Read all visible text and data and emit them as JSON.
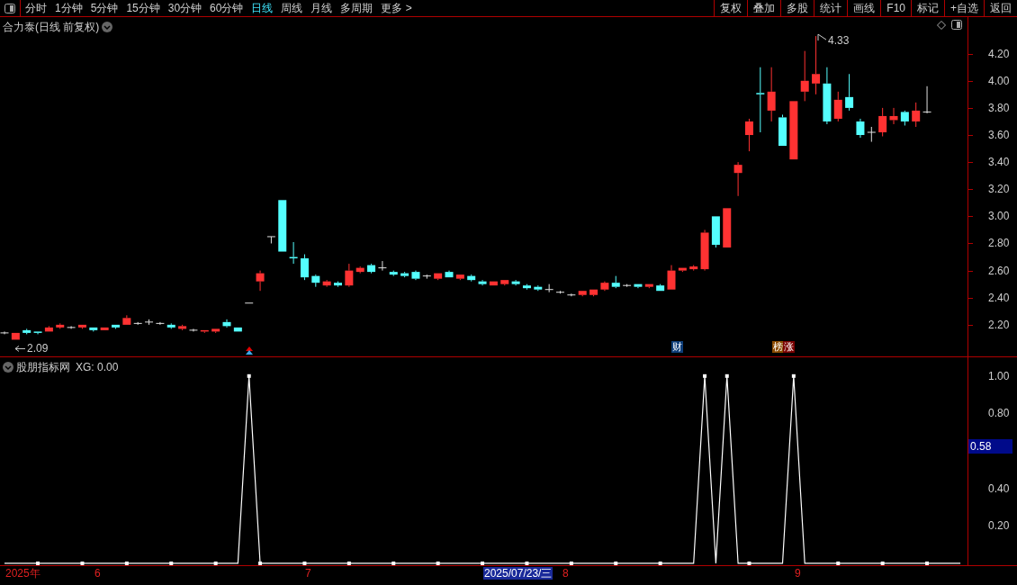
{
  "toolbar": {
    "periods": [
      {
        "label": "分时",
        "selected": false
      },
      {
        "label": "1分钟",
        "selected": false
      },
      {
        "label": "5分钟",
        "selected": false
      },
      {
        "label": "15分钟",
        "selected": false
      },
      {
        "label": "30分钟",
        "selected": false
      },
      {
        "label": "60分钟",
        "selected": false
      },
      {
        "label": "日线",
        "selected": true
      },
      {
        "label": "周线",
        "selected": false
      },
      {
        "label": "月线",
        "selected": false
      },
      {
        "label": "多周期",
        "selected": false
      },
      {
        "label": "更多 >",
        "selected": false
      }
    ],
    "actions": [
      "复权",
      "叠加",
      "多股",
      "统计",
      "画线",
      "F10",
      "标记",
      "+自选",
      "返回"
    ]
  },
  "main_chart": {
    "title": "合力泰(日线 前复权)",
    "low_label": "2.09",
    "high_label": "4.33",
    "markers": [
      {
        "label": "财",
        "color": "#0d3d78"
      },
      {
        "label": "榜",
        "color": "#8a4a00"
      },
      {
        "label": "涨",
        "color": "#7a0000"
      }
    ],
    "chart_data": {
      "type": "candlestick",
      "ylim": [
        1.96,
        4.47
      ],
      "yticks": [
        {
          "value": 4.2,
          "label": "4.20"
        },
        {
          "value": 4.0,
          "label": "4.00"
        },
        {
          "value": 3.8,
          "label": "3.80"
        },
        {
          "value": 3.6,
          "label": "3.60"
        },
        {
          "value": 3.4,
          "label": "3.40"
        },
        {
          "value": 3.2,
          "label": "3.20"
        },
        {
          "value": 3.0,
          "label": "3.00"
        },
        {
          "value": 2.8,
          "label": "2.80"
        },
        {
          "value": 2.6,
          "label": "2.60"
        },
        {
          "value": 2.4,
          "label": "2.40"
        },
        {
          "value": 2.2,
          "label": "2.20"
        }
      ],
      "categories": [
        null,
        null,
        null,
        null,
        null,
        null,
        null,
        null,
        null,
        null,
        null,
        null,
        null,
        null,
        null,
        null,
        null,
        null,
        null,
        null,
        null,
        null,
        null,
        null,
        null,
        null,
        null,
        null,
        null,
        null,
        null,
        null,
        null,
        null,
        null,
        null,
        null,
        null,
        null,
        null,
        null,
        null,
        null,
        null,
        null,
        null,
        null,
        null,
        null,
        null,
        null,
        null,
        null,
        null,
        null,
        null,
        null,
        null,
        null,
        null,
        null,
        null,
        null,
        null,
        null,
        null,
        null,
        null,
        null,
        null,
        null,
        null,
        null,
        null,
        null,
        null,
        null,
        null,
        null,
        null,
        null,
        null,
        null,
        null
      ],
      "ohlc": [
        [
          2.14,
          2.15,
          2.13,
          2.14
        ],
        [
          2.09,
          2.14,
          2.09,
          2.14
        ],
        [
          2.16,
          2.17,
          2.13,
          2.14
        ],
        [
          2.15,
          2.15,
          2.13,
          2.14
        ],
        [
          2.15,
          2.19,
          2.15,
          2.18
        ],
        [
          2.18,
          2.21,
          2.17,
          2.2
        ],
        [
          2.18,
          2.19,
          2.17,
          2.18
        ],
        [
          2.18,
          2.2,
          2.17,
          2.2
        ],
        [
          2.18,
          2.18,
          2.15,
          2.16
        ],
        [
          2.16,
          2.18,
          2.16,
          2.18
        ],
        [
          2.2,
          2.2,
          2.17,
          2.18
        ],
        [
          2.2,
          2.27,
          2.2,
          2.25
        ],
        [
          2.21,
          2.22,
          2.2,
          2.21
        ],
        [
          2.22,
          2.24,
          2.2,
          2.22
        ],
        [
          2.21,
          2.22,
          2.2,
          2.21
        ],
        [
          2.2,
          2.21,
          2.17,
          2.18
        ],
        [
          2.17,
          2.2,
          2.16,
          2.19
        ],
        [
          2.16,
          2.17,
          2.15,
          2.16
        ],
        [
          2.15,
          2.16,
          2.14,
          2.16
        ],
        [
          2.15,
          2.17,
          2.14,
          2.17
        ],
        [
          2.22,
          2.24,
          2.18,
          2.19
        ],
        [
          2.18,
          2.18,
          2.15,
          2.15
        ],
        [
          2.36,
          2.36,
          2.36,
          2.36
        ],
        [
          2.52,
          2.6,
          2.45,
          2.58
        ],
        [
          2.85,
          2.85,
          2.8,
          2.85
        ],
        [
          3.12,
          3.12,
          2.74,
          2.74
        ],
        [
          2.7,
          2.81,
          2.65,
          2.69
        ],
        [
          2.69,
          2.72,
          2.53,
          2.55
        ],
        [
          2.56,
          2.57,
          2.48,
          2.51
        ],
        [
          2.49,
          2.53,
          2.48,
          2.52
        ],
        [
          2.51,
          2.52,
          2.48,
          2.49
        ],
        [
          2.49,
          2.65,
          2.48,
          2.6
        ],
        [
          2.59,
          2.63,
          2.58,
          2.62
        ],
        [
          2.64,
          2.65,
          2.58,
          2.59
        ],
        [
          2.62,
          2.67,
          2.6,
          2.62
        ],
        [
          2.59,
          2.6,
          2.56,
          2.57
        ],
        [
          2.58,
          2.59,
          2.55,
          2.56
        ],
        [
          2.59,
          2.6,
          2.53,
          2.54
        ],
        [
          2.56,
          2.57,
          2.54,
          2.56
        ],
        [
          2.54,
          2.58,
          2.53,
          2.58
        ],
        [
          2.59,
          2.6,
          2.55,
          2.55
        ],
        [
          2.54,
          2.57,
          2.53,
          2.57
        ],
        [
          2.56,
          2.57,
          2.52,
          2.53
        ],
        [
          2.52,
          2.53,
          2.49,
          2.5
        ],
        [
          2.49,
          2.52,
          2.49,
          2.52
        ],
        [
          2.5,
          2.53,
          2.49,
          2.53
        ],
        [
          2.52,
          2.53,
          2.49,
          2.5
        ],
        [
          2.49,
          2.5,
          2.46,
          2.47
        ],
        [
          2.48,
          2.49,
          2.45,
          2.46
        ],
        [
          2.46,
          2.5,
          2.44,
          2.46
        ],
        [
          2.44,
          2.45,
          2.43,
          2.44
        ],
        [
          2.42,
          2.43,
          2.41,
          2.42
        ],
        [
          2.42,
          2.45,
          2.41,
          2.45
        ],
        [
          2.42,
          2.46,
          2.41,
          2.46
        ],
        [
          2.46,
          2.52,
          2.45,
          2.51
        ],
        [
          2.51,
          2.56,
          2.47,
          2.48
        ],
        [
          2.49,
          2.5,
          2.48,
          2.49
        ],
        [
          2.5,
          2.5,
          2.47,
          2.48
        ],
        [
          2.48,
          2.5,
          2.47,
          2.5
        ],
        [
          2.49,
          2.5,
          2.45,
          2.45
        ],
        [
          2.46,
          2.64,
          2.46,
          2.6
        ],
        [
          2.6,
          2.62,
          2.59,
          2.62
        ],
        [
          2.61,
          2.64,
          2.6,
          2.63
        ],
        [
          2.61,
          2.9,
          2.6,
          2.88
        ],
        [
          3.0,
          3.0,
          2.77,
          2.79
        ],
        [
          2.77,
          3.06,
          2.77,
          3.06
        ],
        [
          3.32,
          3.4,
          3.15,
          3.38
        ],
        [
          3.6,
          3.72,
          3.48,
          3.7
        ],
        [
          3.91,
          4.1,
          3.62,
          3.9
        ],
        [
          3.78,
          4.1,
          3.7,
          3.92
        ],
        [
          3.73,
          3.75,
          3.52,
          3.52
        ],
        [
          3.42,
          3.85,
          3.42,
          3.85
        ],
        [
          3.92,
          4.22,
          3.85,
          4.0
        ],
        [
          3.98,
          4.33,
          3.9,
          4.05
        ],
        [
          3.98,
          4.1,
          3.68,
          3.7
        ],
        [
          3.72,
          3.92,
          3.7,
          3.86
        ],
        [
          3.88,
          4.05,
          3.78,
          3.8
        ],
        [
          3.7,
          3.72,
          3.58,
          3.6
        ],
        [
          3.62,
          3.66,
          3.55,
          3.62
        ],
        [
          3.62,
          3.8,
          3.59,
          3.74
        ],
        [
          3.71,
          3.8,
          3.68,
          3.74
        ],
        [
          3.77,
          3.78,
          3.67,
          3.7
        ],
        [
          3.7,
          3.84,
          3.66,
          3.78
        ],
        [
          3.77,
          3.96,
          3.76,
          3.77
        ]
      ]
    }
  },
  "indicator": {
    "title": "股朋指标网",
    "reading": ": 0.00",
    "current_value": "0.58",
    "chart_data": {
      "type": "line",
      "ylim": [
        -0.01,
        1.1
      ],
      "categories": [
        null,
        null,
        null,
        null,
        null,
        null,
        null,
        null,
        null,
        null,
        null,
        null,
        null,
        null,
        null,
        null,
        null,
        null,
        null,
        null,
        null,
        null,
        null,
        null,
        null,
        null,
        null,
        null,
        null,
        null,
        null,
        null,
        null,
        null,
        null,
        null,
        null,
        null,
        null,
        null,
        null,
        null,
        null,
        null,
        null,
        null,
        null,
        null,
        null,
        null,
        null,
        null,
        null,
        null,
        null,
        null,
        null,
        null,
        null,
        null,
        null,
        null,
        null,
        null,
        null,
        null,
        null,
        null,
        null,
        null,
        null,
        null,
        null,
        null,
        null,
        null,
        null,
        null,
        null,
        null,
        null,
        null,
        null,
        null,
        null,
        null,
        null
      ],
      "yticks": [
        {
          "value": 1,
          "label": "1.00"
        },
        {
          "value": 0.8,
          "label": "0.80"
        },
        {
          "value": 0.4,
          "label": "0.40"
        },
        {
          "value": 0.2,
          "label": "0.20"
        }
      ],
      "series": [
        {
          "name": "XG",
          "color": "#ffffff",
          "values": [
            0,
            0,
            0,
            0,
            0,
            0,
            0,
            0,
            0,
            0,
            0,
            0,
            0,
            0,
            0,
            0,
            0,
            0,
            0,
            0,
            0,
            0,
            1,
            0,
            0,
            0,
            0,
            0,
            0,
            0,
            0,
            0,
            0,
            0,
            0,
            0,
            0,
            0,
            0,
            0,
            0,
            0,
            0,
            0,
            0,
            0,
            0,
            0,
            0,
            0,
            0,
            0,
            0,
            0,
            0,
            0,
            0,
            0,
            0,
            0,
            0,
            0,
            0,
            1,
            0,
            1,
            0,
            0,
            0,
            0,
            0,
            1,
            0,
            0,
            0,
            0,
            0,
            0,
            0,
            0,
            0,
            0,
            0,
            0,
            0,
            0,
            0
          ]
        }
      ]
    }
  },
  "date_axis": [
    {
      "label": "2025年",
      "selected": false
    },
    {
      "label": "6",
      "selected": false
    },
    {
      "label": "7",
      "selected": false
    },
    {
      "label": "2025/07/23/三",
      "selected": true
    },
    {
      "label": "8",
      "selected": false
    },
    {
      "label": "9",
      "selected": false
    }
  ]
}
